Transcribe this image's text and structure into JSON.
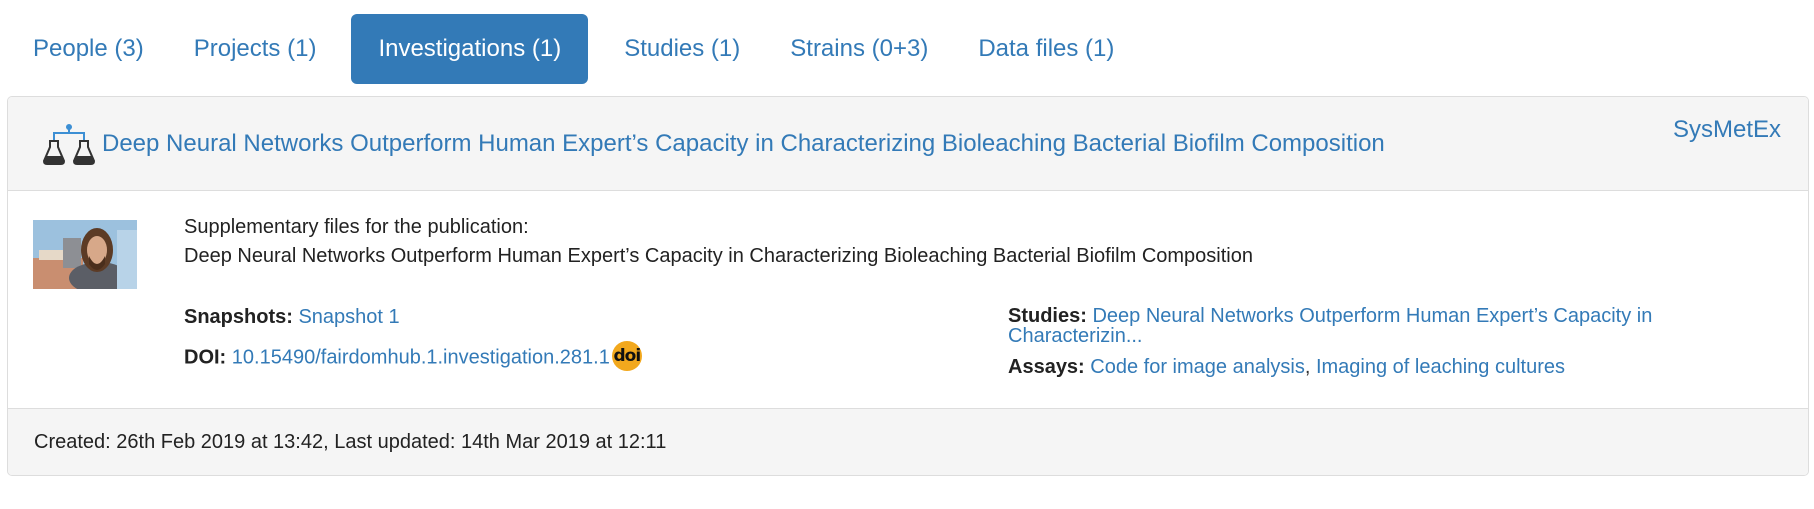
{
  "tabs": [
    {
      "label": "People (3)",
      "active": false
    },
    {
      "label": "Projects (1)",
      "active": false
    },
    {
      "label": "Investigations (1)",
      "active": true
    },
    {
      "label": "Studies (1)",
      "active": false
    },
    {
      "label": "Strains (0+3)",
      "active": false
    },
    {
      "label": "Data files (1)",
      "active": false
    }
  ],
  "investigation": {
    "icon": "investigation-flasks-icon",
    "title": "Deep Neural Networks Outperform Human Expert’s Capacity in Characterizing Bioleaching Bacterial Biofilm Composition",
    "project": "SysMetEx",
    "description_line1": "Supplementary files for the publication:",
    "description_line2": "Deep Neural Networks Outperform Human Expert’s Capacity in Characterizing Bioleaching Bacterial Biofilm Composition",
    "snapshots_label": "Snapshots:",
    "snapshot": "Snapshot 1",
    "doi_label": "DOI:",
    "doi": "10.15490/fairdomhub.1.investigation.281.1",
    "doi_badge": "doi",
    "studies_label": "Studies:",
    "study": "Deep Neural Networks Outperform Human Expert’s Capacity in Characterizin...",
    "assays_label": "Assays:",
    "assays": [
      "Code for image analysis",
      "Imaging of leaching cultures"
    ],
    "assay_separator": ", "
  },
  "footer": {
    "text": "Created: 26th Feb 2019 at 13:42, Last updated: 14th Mar 2019 at 12:11"
  },
  "colors": {
    "accent": "#337ab7",
    "panel_bg": "#f5f5f5",
    "doi_badge": "#f2a81d"
  }
}
